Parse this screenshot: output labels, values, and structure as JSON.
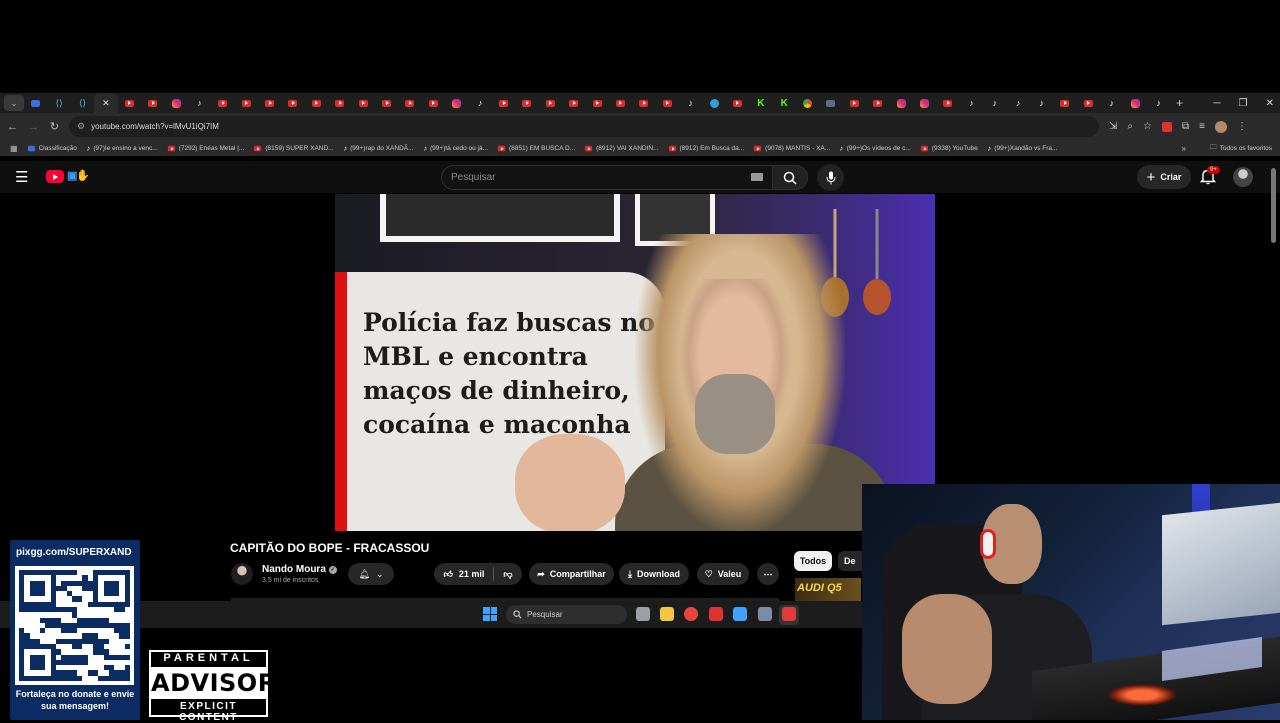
{
  "browser": {
    "url": "youtube.com/watch?v=lMvU1iQi7IM",
    "tab_favicons": [
      "yt",
      "yt",
      "ig",
      "tk",
      "yt",
      "yt",
      "yt",
      "yt",
      "yt",
      "yt",
      "yt",
      "yt",
      "yt",
      "yt",
      "ig",
      "tk",
      "yt",
      "yt",
      "yt",
      "yt",
      "yt",
      "yt",
      "yt",
      "yt",
      "tk",
      "tg",
      "yt",
      "kk",
      "kk",
      "ch",
      "gen",
      "yt",
      "yt",
      "ig",
      "ig",
      "yt",
      "tk",
      "tk",
      "tk",
      "tk",
      "yt",
      "yt",
      "tk",
      "ig",
      "tk"
    ],
    "bookmarks": [
      {
        "icon": "bl",
        "label": "Classificação"
      },
      {
        "icon": "tk",
        "label": "(97)Ie ensino a venc..."
      },
      {
        "icon": "yt",
        "label": "(7292) Enéas Metal |..."
      },
      {
        "icon": "yt",
        "label": "(8159) SUPER XAND..."
      },
      {
        "icon": "tk",
        "label": "(99+)rap do XANDÃ..."
      },
      {
        "icon": "tk",
        "label": "(99+)tá cedo ou já..."
      },
      {
        "icon": "yt",
        "label": "(8851) EM BUSCA D..."
      },
      {
        "icon": "yt",
        "label": "(8912) VAI XANDIN..."
      },
      {
        "icon": "yt",
        "label": "(8912) Em Busca da..."
      },
      {
        "icon": "yt",
        "label": "(9078) MANTIS - XA..."
      },
      {
        "icon": "tk",
        "label": "(99+)Os vídeos de c..."
      },
      {
        "icon": "yt",
        "label": "(9338) YouTube"
      },
      {
        "icon": "tk",
        "label": "(99+)Xandão vs Fra..."
      }
    ],
    "all_bookmarks_label": "Todos os favoritos"
  },
  "youtube": {
    "search_placeholder": "Pesquisar",
    "create_label": "Criar",
    "notif_count": "9+",
    "video": {
      "overlay_text": "Polícia faz buscas no MBL e encontra maços de dinheiro, cocaína e maconha",
      "title": "CAPITÃO DO BOPE - FRACASSOU",
      "channel": "Nando Moura",
      "subscribers": "3,5 mi de inscritos",
      "likes": "21 mil",
      "share_label": "Compartilhar",
      "download_label": "Download",
      "valeu_label": "Valeu"
    },
    "chips": [
      "Todos",
      "De N"
    ],
    "ad_thumb_text": "AUDI Q5"
  },
  "taskbar": {
    "search_placeholder": "Pesquisar",
    "apps": [
      {
        "name": "task-view",
        "color": "#9aa0a6"
      },
      {
        "name": "file-explorer",
        "color": "#f4c542"
      },
      {
        "name": "chrome",
        "color": "#e8453c"
      },
      {
        "name": "obs",
        "color": "#d33"
      },
      {
        "name": "editor",
        "color": "#3fa2ff"
      },
      {
        "name": "settings",
        "color": "#7a8ca8"
      },
      {
        "name": "steam",
        "color": "#e03b3b"
      }
    ]
  },
  "overlay": {
    "qr_url": "pixgg.com/SUPERXAND",
    "qr_caption": "Fortaleça no donate e envie sua mensagem!",
    "advisory_top": "PARENTAL",
    "advisory_mid": "ADVISORY",
    "advisory_bottom": "EXPLICIT CONTENT"
  },
  "colors": {
    "yt_red": "#ff0033",
    "qr_panel": "#0b2c62",
    "page_bg": "#0f0f0f"
  }
}
